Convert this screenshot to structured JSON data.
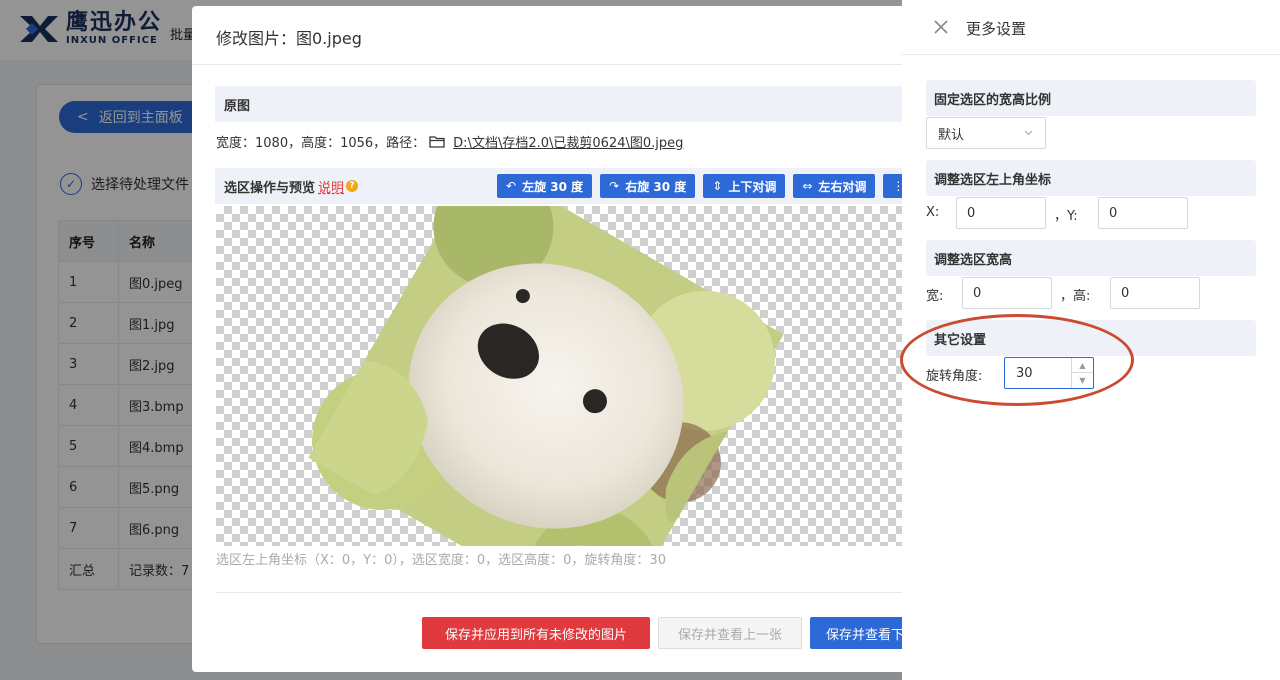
{
  "app": {
    "logo_cn": "鹰迅办公",
    "logo_en": "INXUN OFFICE",
    "top_menu": "批量",
    "back_button": "返回到主面板",
    "select_files": "选择待处理文件",
    "table": {
      "headers": [
        "序号",
        "名称"
      ],
      "rows": [
        [
          "1",
          "图0.jpeg"
        ],
        [
          "2",
          "图1.jpg"
        ],
        [
          "3",
          "图2.jpg"
        ],
        [
          "4",
          "图3.bmp"
        ],
        [
          "5",
          "图4.bmp"
        ],
        [
          "6",
          "图5.png"
        ],
        [
          "7",
          "图6.png"
        ]
      ],
      "summary": [
        "汇总",
        "记录数：7"
      ]
    }
  },
  "modal": {
    "title": "修改图片：图0.jpeg",
    "original_section": "原图",
    "original_info": "宽度：1080，高度：1056，路径：",
    "original_path": "D:\\文档\\存档2.0\\已裁剪0624\\图0.jpeg",
    "crop_section": "选区操作与预览",
    "help_link": "说明",
    "help_icon": "?",
    "tools": [
      {
        "icon": "rotate-left-icon",
        "label": "左旋 30 度"
      },
      {
        "icon": "rotate-right-icon",
        "label": "右旋 30 度"
      },
      {
        "icon": "flip-vertical-icon",
        "label": "上下对调"
      },
      {
        "icon": "flip-horizontal-icon",
        "label": "左右对调"
      }
    ],
    "status": "选区左上角坐标（X：0，Y：0），选区宽度：0，选区高度：0，旋转角度：30",
    "buttons": {
      "apply_all": "保存并应用到所有未修改的图片",
      "prev": "保存并查看上一张",
      "next": "保存并查看下"
    }
  },
  "drawer": {
    "title": "更多设置",
    "ratio_section": "固定选区的宽高比例",
    "ratio_value": "默认",
    "coord_section": "调整选区左上角坐标",
    "x_label": "X:",
    "x_value": "0",
    "y_label": "，Y:",
    "y_value": "0",
    "size_section": "调整选区宽高",
    "w_label": "宽:",
    "w_value": "0",
    "h_label": "，高:",
    "h_value": "0",
    "other_section": "其它设置",
    "rotate_label": "旋转角度:",
    "rotate_value": "30"
  },
  "colors": {
    "primary": "#2e69d8",
    "danger": "#e0393e",
    "highlight_ring": "#cc4a30"
  }
}
